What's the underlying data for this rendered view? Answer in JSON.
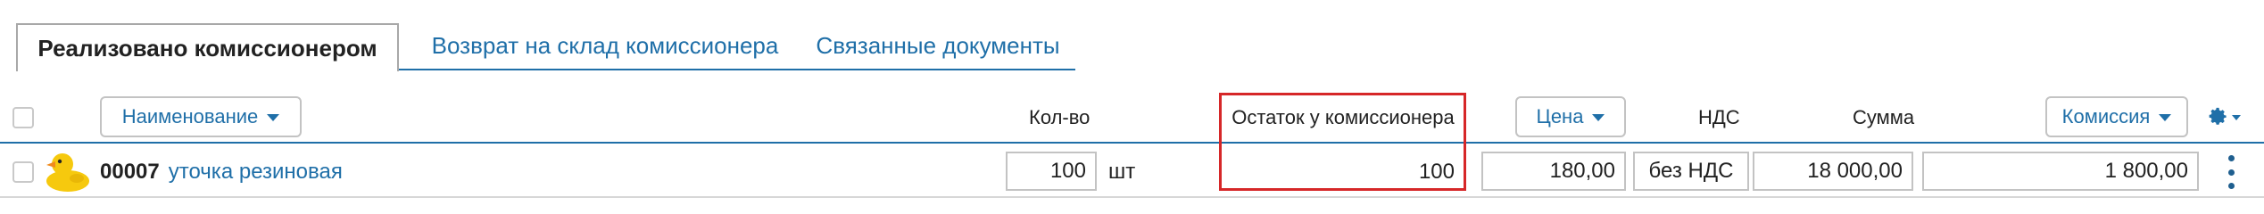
{
  "tabs": {
    "active": "Реализовано комиссионером",
    "return": "Возврат на склад комиссионера",
    "related": "Связанные документы"
  },
  "header": {
    "name_button": "Наименование",
    "qty": "Кол-во",
    "remainder": "Остаток у комиссионера",
    "price_button": "Цена",
    "vat": "НДС",
    "sum": "Сумма",
    "commission_button": "Комиссия"
  },
  "row": {
    "code": "00007",
    "name": "уточка резиновая",
    "qty": "100",
    "unit": "шт",
    "remainder": "100",
    "price": "180,00",
    "vat": "без НДС",
    "sum": "18 000,00",
    "commission": "1 800,00"
  },
  "colors": {
    "accent": "#1f6fa8",
    "highlight": "#d62728"
  },
  "icons": [
    "checkbox",
    "duck-thumbnail",
    "gear-icon",
    "kebab-menu-icon"
  ]
}
